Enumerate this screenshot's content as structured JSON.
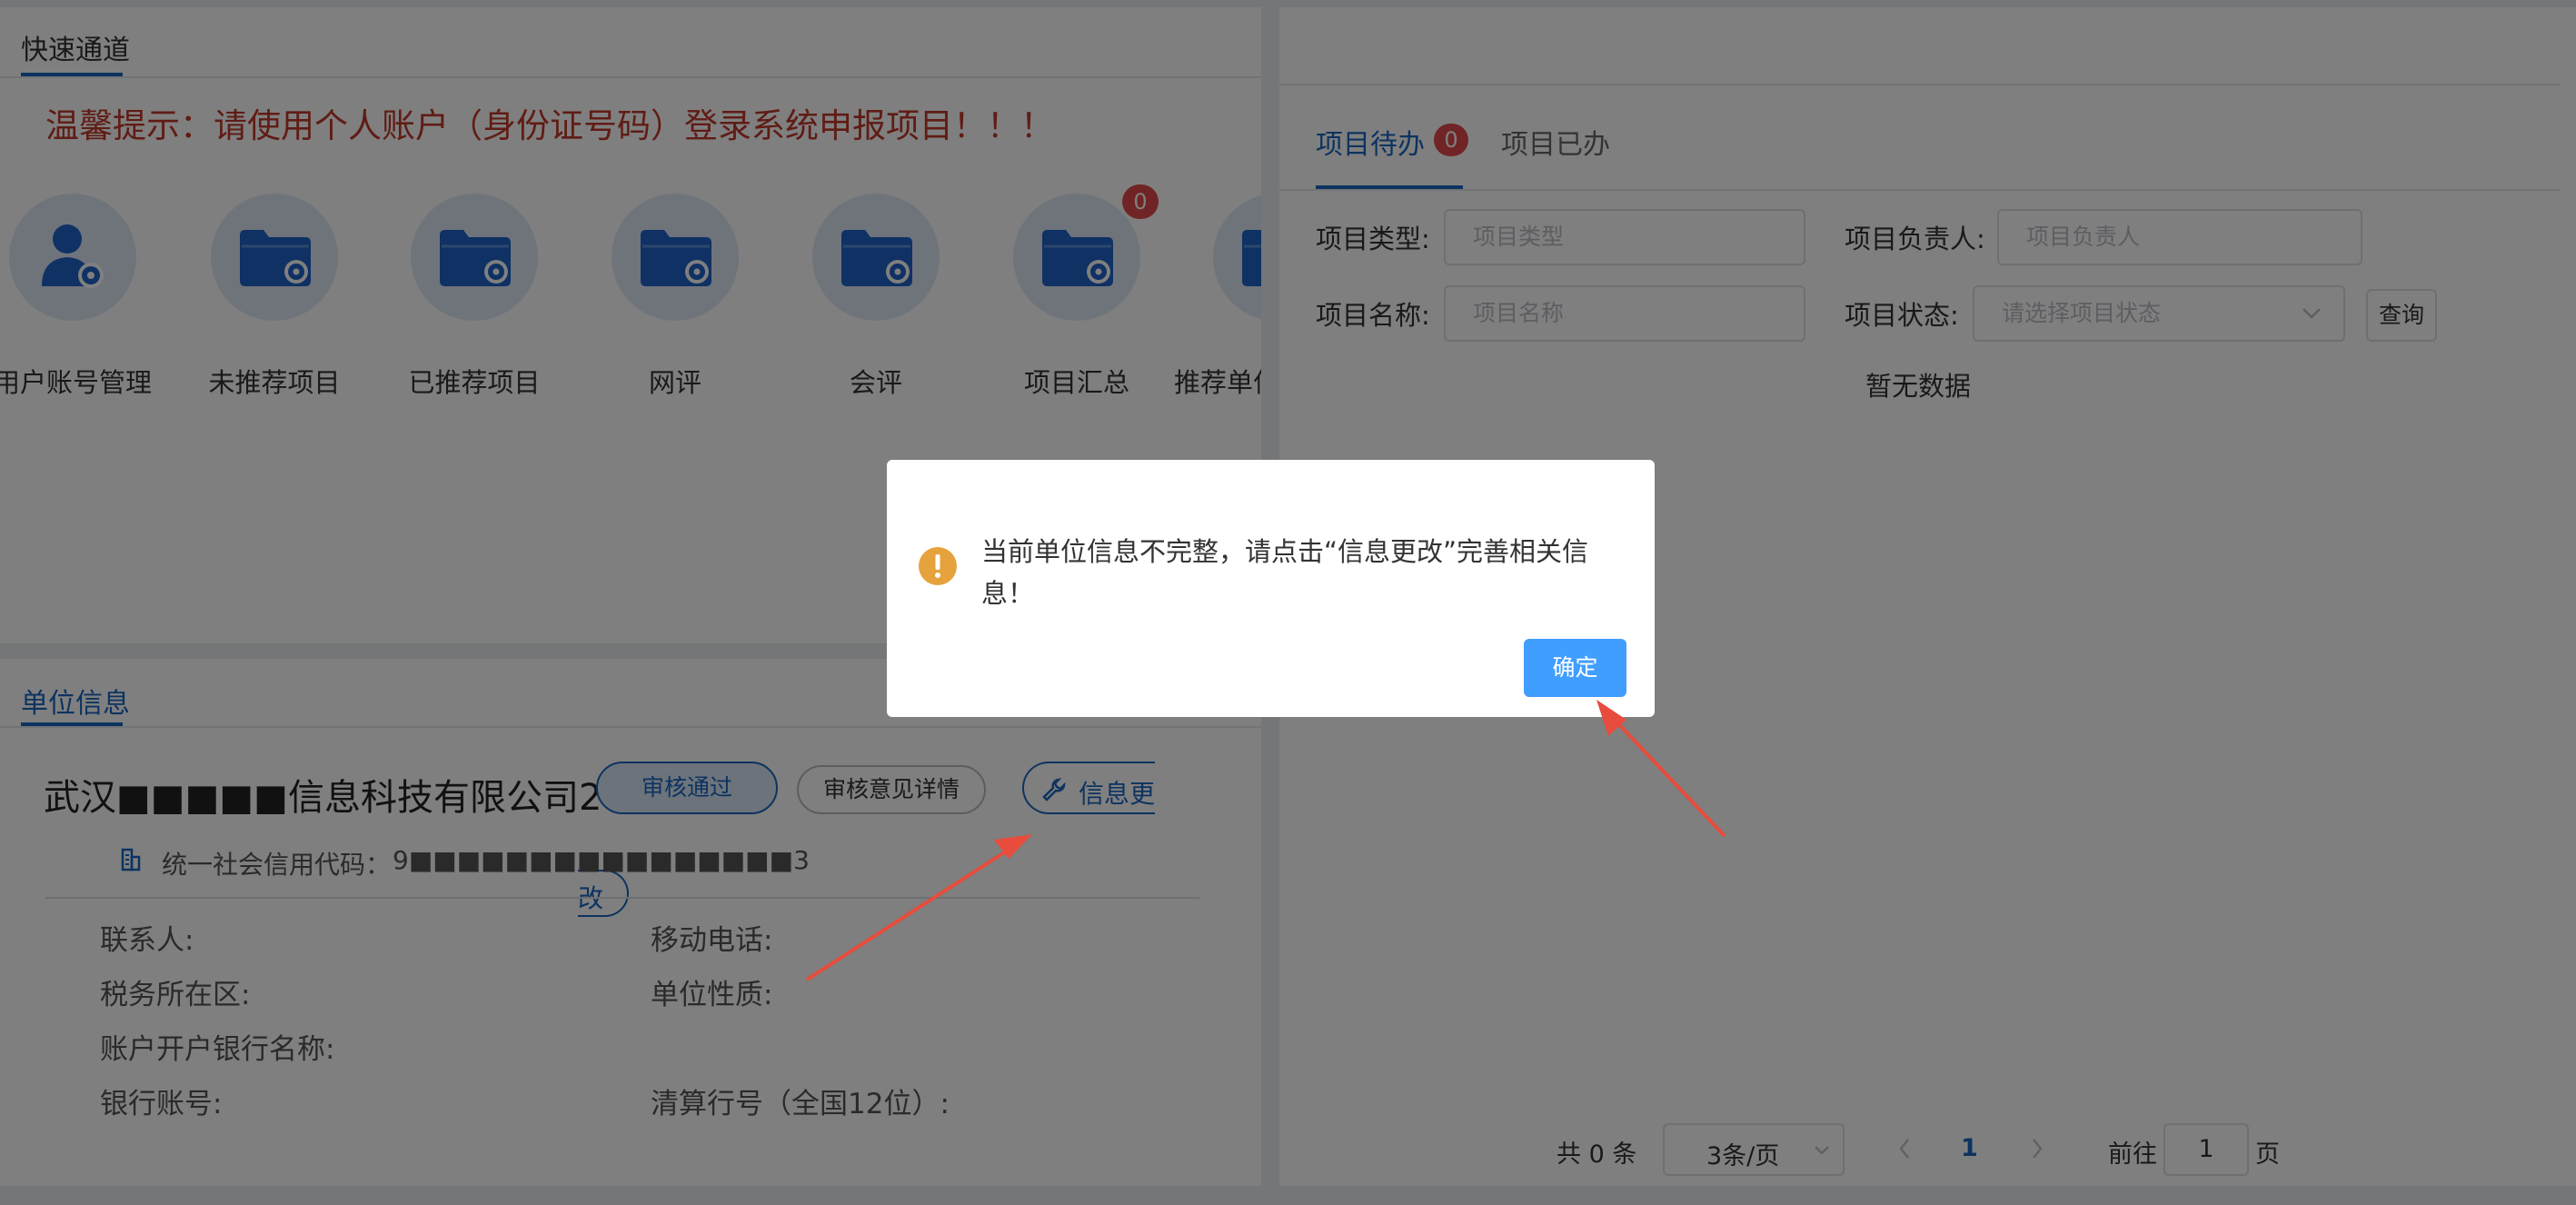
{
  "quick_access": {
    "title": "快速通道",
    "notice": "温馨提示：请使用个人账户（身份证号码）登录系统申报项目！！！",
    "items": [
      {
        "label": "用户账号管理",
        "icon": "user-gear-icon"
      },
      {
        "label": "未推荐项目",
        "icon": "folder-gear-icon"
      },
      {
        "label": "已推荐项目",
        "icon": "folder-gear-icon"
      },
      {
        "label": "网评",
        "icon": "folder-gear-icon"
      },
      {
        "label": "会评",
        "icon": "folder-gear-icon"
      },
      {
        "label": "项目汇总",
        "icon": "folder-gear-icon",
        "badge": "0"
      },
      {
        "label": "推荐单位",
        "icon": "folder-gear-icon"
      }
    ]
  },
  "unit_info": {
    "title": "单位信息",
    "company_name": "武汉■■■■■信息科技有限公司2",
    "status_button": "审核通过",
    "review_button": "审核意见详情",
    "edit_button": "信息更",
    "edit_button_wrap": "改",
    "credit_code_label": "统一社会信用代码：",
    "credit_code_value": "9■■■■■■■■■■■■■■■■3",
    "fields": [
      {
        "label": "联系人:",
        "value": ""
      },
      {
        "label": "移动电话:",
        "value": ""
      },
      {
        "label": "税务所在区:",
        "value": ""
      },
      {
        "label": "单位性质:",
        "value": ""
      },
      {
        "label": "账户开户银行名称:",
        "value": ""
      },
      {
        "label": "银行账号:",
        "value": ""
      },
      {
        "label": "清算行号（全国12位）:",
        "value": ""
      }
    ]
  },
  "projects": {
    "tabs": [
      {
        "label": "项目待办",
        "badge": "0",
        "active": true
      },
      {
        "label": "项目已办",
        "active": false
      }
    ],
    "filters": {
      "type_label": "项目类型:",
      "type_placeholder": "项目类型",
      "owner_label": "项目负责人:",
      "owner_placeholder": "项目负责人",
      "name_label": "项目名称:",
      "name_placeholder": "项目名称",
      "status_label": "项目状态:",
      "status_placeholder": "请选择项目状态",
      "query_button": "查询"
    },
    "empty_text": "暂无数据",
    "pagination": {
      "total": "共 0 条",
      "page_size": "3条/页",
      "current_page": "1",
      "goto_label": "前往",
      "goto_value": "1",
      "page_suffix": "页"
    }
  },
  "dialog": {
    "message_line1": "当前单位信息不完整，请点击“信息更改”完善相关信",
    "message_line2": "息！",
    "confirm_button": "确定",
    "icon": "warning-icon"
  },
  "colors": {
    "accent": "#1967c1",
    "notice_red": "#c0392b",
    "warning": "#e6a23c",
    "confirm": "#409eff",
    "arrow": "#e74c3c"
  }
}
